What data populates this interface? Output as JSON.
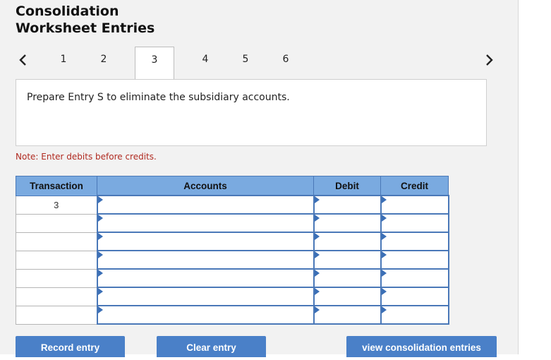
{
  "header": {
    "title_line1": "Consolidation",
    "title_line2": "Worksheet Entries"
  },
  "tabs": {
    "prev_icon": "chevron-left-icon",
    "next_icon": "chevron-right-icon",
    "items": [
      {
        "label": "1"
      },
      {
        "label": "2"
      },
      {
        "label": "3",
        "active": true
      },
      {
        "label": "4"
      },
      {
        "label": "5"
      },
      {
        "label": "6"
      }
    ]
  },
  "instruction": "Prepare Entry S to eliminate the subsidiary accounts.",
  "note": "Note: Enter debits before credits.",
  "table": {
    "headers": {
      "transaction": "Transaction",
      "accounts": "Accounts",
      "debit": "Debit",
      "credit": "Credit"
    },
    "rows": [
      {
        "transaction": "3",
        "account": "",
        "debit": "",
        "credit": ""
      },
      {
        "transaction": "",
        "account": "",
        "debit": "",
        "credit": ""
      },
      {
        "transaction": "",
        "account": "",
        "debit": "",
        "credit": ""
      },
      {
        "transaction": "",
        "account": "",
        "debit": "",
        "credit": ""
      },
      {
        "transaction": "",
        "account": "",
        "debit": "",
        "credit": ""
      },
      {
        "transaction": "",
        "account": "",
        "debit": "",
        "credit": ""
      },
      {
        "transaction": "",
        "account": "",
        "debit": "",
        "credit": ""
      }
    ]
  },
  "buttons": {
    "record": "Record entry",
    "clear": "Clear entry",
    "view": "view consolidation entries"
  },
  "colors": {
    "header_bg": "#7aaae0",
    "grid_border": "#4a78b8",
    "button_bg": "#4a80c8",
    "note_text": "#b02a20",
    "panel_bg": "#f2f2f2"
  }
}
